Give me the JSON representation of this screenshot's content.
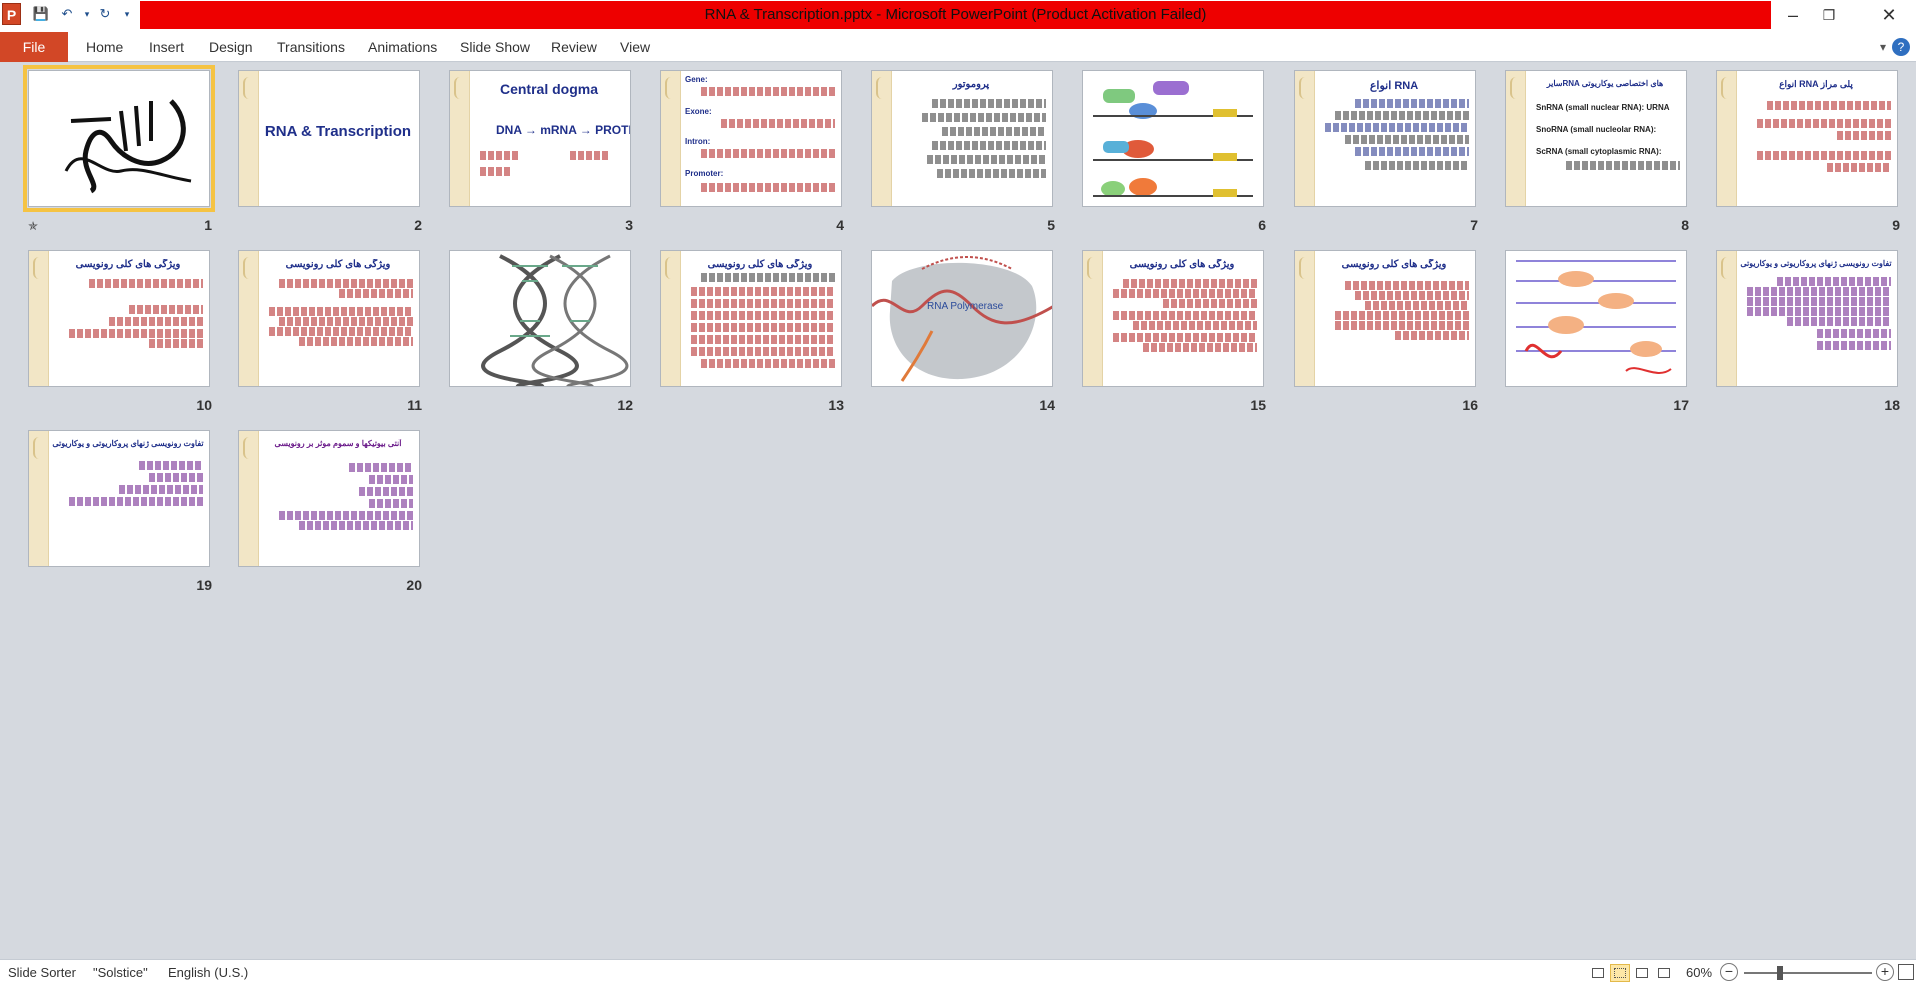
{
  "window": {
    "title": "RNA & Transcription.pptx  -  Microsoft PowerPoint (Product Activation Failed)",
    "app_icon": "P",
    "title_color": "#ee0000"
  },
  "quick_access": [
    "save-icon",
    "undo-icon",
    "redo-icon",
    "customize-icon"
  ],
  "ribbon": {
    "file": "File",
    "tabs": [
      "Home",
      "Insert",
      "Design",
      "Transitions",
      "Animations",
      "Slide Show",
      "Review",
      "View"
    ],
    "file_color": "#d24726"
  },
  "slides": [
    {
      "num": "1",
      "kind": "calligraphy"
    },
    {
      "num": "2",
      "kind": "title",
      "title": "RNA & Transcription"
    },
    {
      "num": "3",
      "kind": "central",
      "title": "Central dogma",
      "flow": "DNA → mRNA → PROTEIN"
    },
    {
      "num": "4",
      "kind": "text",
      "labels": [
        "Gene:",
        "Exone:",
        "Intron:",
        "Promoter:"
      ]
    },
    {
      "num": "5",
      "kind": "text",
      "heading": "پروموتور"
    },
    {
      "num": "6",
      "kind": "figure"
    },
    {
      "num": "7",
      "kind": "text",
      "heading": "انواع RNA"
    },
    {
      "num": "8",
      "kind": "text",
      "heading": "سایرRNA های اختصاصی یوکاریوتی",
      "lines": [
        "SnRNA (small nuclear RNA): URNA",
        "SnoRNA (small nucleolar RNA):",
        "ScRNA (small cytoplasmic RNA):"
      ]
    },
    {
      "num": "9",
      "kind": "text",
      "heading": "انواع RNA پلی مراز"
    },
    {
      "num": "10",
      "kind": "text",
      "heading": "ویژگی های کلی رونویسی"
    },
    {
      "num": "11",
      "kind": "text",
      "heading": "ویژگی های کلی رونویسی"
    },
    {
      "num": "12",
      "kind": "helix"
    },
    {
      "num": "13",
      "kind": "text",
      "heading": "ویژگی های کلی رونویسی"
    },
    {
      "num": "14",
      "kind": "polymerase",
      "label": "RNA Polymerase"
    },
    {
      "num": "15",
      "kind": "text",
      "heading": "ویژگی های کلی رونویسی"
    },
    {
      "num": "16",
      "kind": "text",
      "heading": "ویژگی های کلی رونویسی"
    },
    {
      "num": "17",
      "kind": "figure"
    },
    {
      "num": "18",
      "kind": "text",
      "heading": "تفاوت رونویسی ژنهای پروکاریوتی و یوکاریوتی"
    },
    {
      "num": "19",
      "kind": "text",
      "heading": "تفاوت رونویسی ژنهای پروکاریوتی و یوکاریوتی"
    },
    {
      "num": "20",
      "kind": "text",
      "heading": "آنتی بیوتیکها و سموم موثر بر رونویسی"
    }
  ],
  "selected_slide": "1",
  "statusbar": {
    "view": "Slide Sorter",
    "theme": "\"Solstice\"",
    "language": "English (U.S.)",
    "zoom": "60%",
    "zoom_level": 0.6
  }
}
